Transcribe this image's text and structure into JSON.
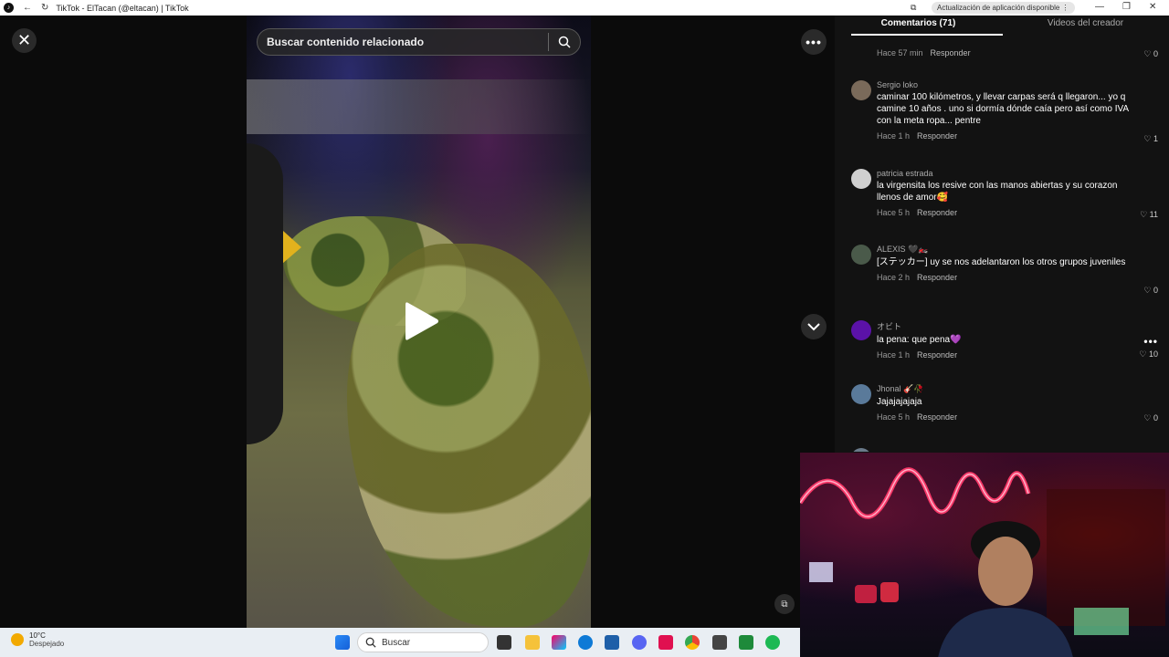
{
  "browser": {
    "title": "TikTok - ElTacan (@eltacan) | TikTok",
    "update_label": "Actualización de aplicación disponible"
  },
  "video": {
    "search_placeholder": "Buscar contenido relacionado"
  },
  "tabs": [
    {
      "label": "Comentarios (71)",
      "active": true
    },
    {
      "label": "Videos del creador",
      "active": false
    }
  ],
  "partial_comment": {
    "time": "Hace 57 min",
    "reply": "Responder",
    "likes": "0"
  },
  "comments": [
    {
      "user": "Sergio loko",
      "text": "caminar 100 kilómetros, y llevar carpas será q llegaron... yo q camine 10 años . uno si dormía dónde caía pero así como IVA con la meta ropa... pentre",
      "time": "Hace 1 h",
      "reply": "Responder",
      "likes": "1",
      "avatar_color": "#7a6a5a"
    },
    {
      "user": "patricia estrada",
      "text": "la virgensita los resive con las manos abiertas y su corazon llenos de amor🥰",
      "time": "Hace 5 h",
      "reply": "Responder",
      "likes": "11",
      "avatar_color": "#cfcfcf"
    },
    {
      "user": "ALEXIS 🖤🏍️",
      "text": "[ステッカー] uy se nos adelantaron los otros grupos juveniles",
      "time": "Hace 2 h",
      "reply": "Responder",
      "likes": "0",
      "avatar_color": "#4a5a4a"
    },
    {
      "user": "オビト",
      "text": "la pena: que pena💜",
      "time": "Hace 1 h",
      "reply": "Responder",
      "likes": "10",
      "avatar_color": "#5b12a8"
    },
    {
      "user": "Jhonal 🎸🥀",
      "text": "Jajajajajaja",
      "time": "Hace 5 h",
      "reply": "Responder",
      "likes": "0",
      "avatar_color": "#5a7a9a"
    }
  ],
  "taskbar": {
    "temperature": "10°C",
    "condition": "Despejado",
    "search_label": "Buscar"
  },
  "colors": {
    "accent_purple": "#5b12a8",
    "background": "#121212"
  }
}
